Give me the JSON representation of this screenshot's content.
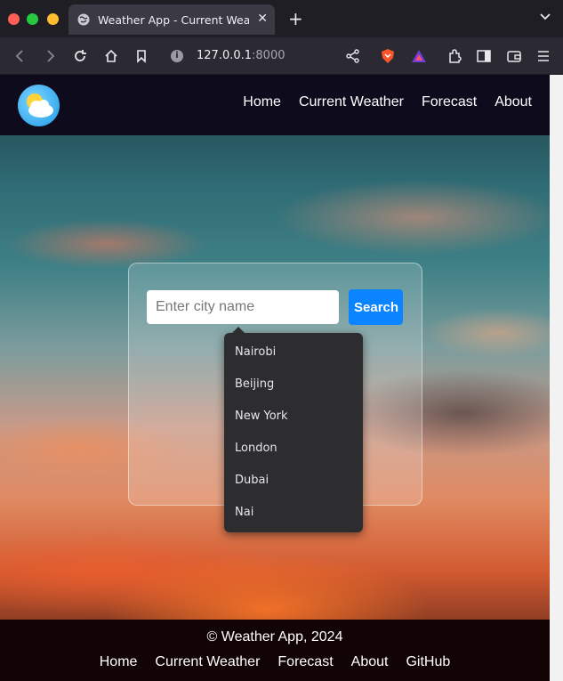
{
  "browser": {
    "tab_title": "Weather App - Current Weati",
    "url_host": "127.0.0.1",
    "url_port": ":8000"
  },
  "navbar": {
    "links": [
      "Home",
      "Current Weather",
      "Forecast",
      "About"
    ]
  },
  "search": {
    "placeholder": "Enter city name",
    "button_label": "Search",
    "suggestions": [
      "Nairobi",
      "Beijing",
      "New York",
      "London",
      "Dubai",
      "Nai"
    ]
  },
  "footer": {
    "copyright": "© Weather App, 2024",
    "links": [
      "Home",
      "Current Weather",
      "Forecast",
      "About",
      "GitHub"
    ]
  },
  "colors": {
    "nav_bg": "#0d0b1c",
    "footer_bg": "#120404",
    "search_button": "#0a84ff"
  }
}
